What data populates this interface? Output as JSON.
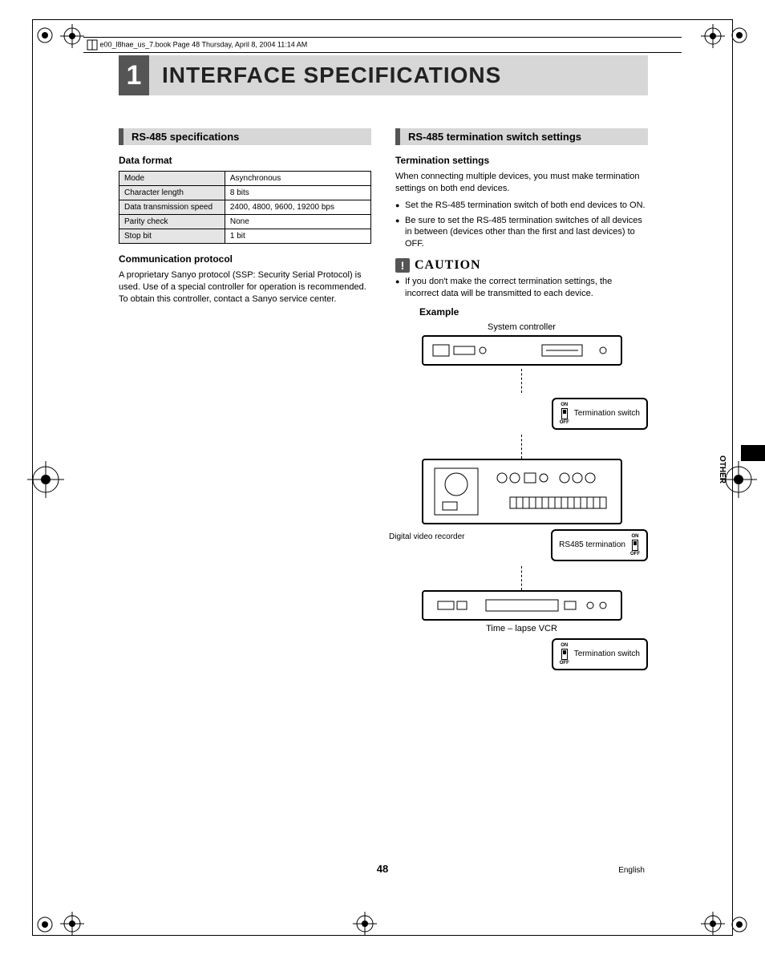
{
  "meta_header": "e00_l8hae_us_7.book  Page 48  Thursday, April 8, 2004   11:14 AM",
  "chapter_number": "1",
  "chapter_title": "INTERFACE SPECIFICATIONS",
  "left": {
    "section": "RS-485 specifications",
    "sub1": "Data format",
    "table": [
      {
        "k": "Mode",
        "v": "Asynchronous"
      },
      {
        "k": "Character length",
        "v": "8 bits"
      },
      {
        "k": "Data transmission speed",
        "v": "2400, 4800, 9600, 19200 bps"
      },
      {
        "k": "Parity check",
        "v": "None"
      },
      {
        "k": "Stop bit",
        "v": "1 bit"
      }
    ],
    "sub2": "Communication protocol",
    "body": "A proprietary Sanyo protocol (SSP: Security Serial Protocol) is used. Use of a special controller for operation is recommended. To obtain this controller, contact a Sanyo service center."
  },
  "right": {
    "section": "RS-485 termination switch settings",
    "sub1": "Termination settings",
    "intro": "When connecting multiple devices, you must make termination settings on both end devices.",
    "bullets": [
      "Set the RS-485 termination switch of both end devices to ON.",
      "Be sure to set the RS-485 termination switches of all devices in between (devices other than the first and last devices) to OFF."
    ],
    "caution_label": "CAUTION",
    "caution_bullets": [
      "If you don't make the correct termination settings, the incorrect data will be transmitted to each device."
    ],
    "example_label": "Example",
    "diagram": {
      "device1": "System controller",
      "switch1": "Termination switch",
      "device2": "Digital video recorder",
      "switch2": "RS485 termination",
      "device3": "Time – lapse VCR",
      "switch3": "Termination switch",
      "on": "ON",
      "off": "OFF"
    }
  },
  "side_tab": "OTHER",
  "page_number": "48",
  "language": "English"
}
